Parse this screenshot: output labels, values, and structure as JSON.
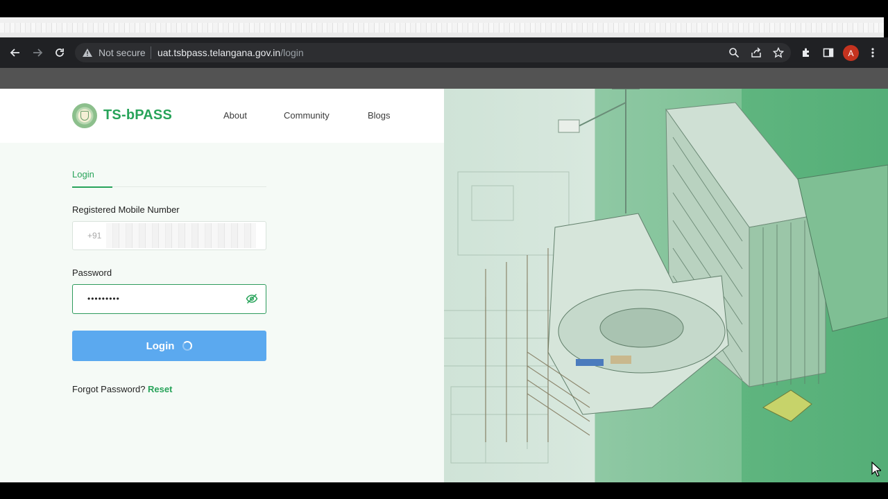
{
  "browser": {
    "security_label": "Not secure",
    "url_host": "uat.tsbpass.telangana.gov.in",
    "url_path": "/login",
    "profile_initial": "A",
    "icons": [
      "back-icon",
      "forward-icon",
      "reload-icon",
      "warning-icon",
      "zoom-icon",
      "share-icon",
      "bookmark-star-icon",
      "extensions-icon",
      "side-panel-icon",
      "menu-icon"
    ]
  },
  "header": {
    "brand": "TS-bPASS",
    "nav": [
      "About",
      "Community",
      "Blogs"
    ]
  },
  "login": {
    "tab_label": "Login",
    "mobile_label": "Registered Mobile Number",
    "mobile_prefix": "+91",
    "password_label": "Password",
    "password_mask": "•••••••••",
    "button_label": "Login",
    "forgot_text": "Forgot Password?",
    "reset_label": "Reset"
  },
  "colors": {
    "brand_green": "#27a359",
    "button_blue": "#5ba9ef",
    "chrome_dark": "#202124"
  }
}
